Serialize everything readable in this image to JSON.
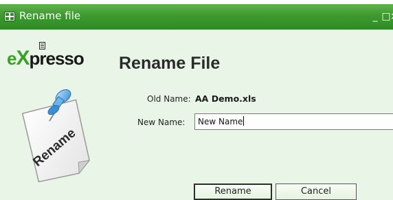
{
  "window": {
    "title": "Rename file",
    "minimize_glyph": "_",
    "maximize_glyph": "□",
    "close_glyph": "×"
  },
  "logo": {
    "part_e": "e",
    "part_x": "X",
    "part_rest": "presso"
  },
  "heading": "Rename File",
  "illustration": {
    "label": "Rename"
  },
  "form": {
    "old_name_label": "Old Name:",
    "old_name_value": "AA Demo.xls",
    "new_name_label": "New Name:",
    "new_name_value": "New Name"
  },
  "buttons": {
    "rename": "Rename",
    "cancel": "Cancel"
  },
  "colors": {
    "titlebar": "#3d9a2f",
    "background": "#e9f5e6",
    "brand_green": "#3aa028"
  }
}
